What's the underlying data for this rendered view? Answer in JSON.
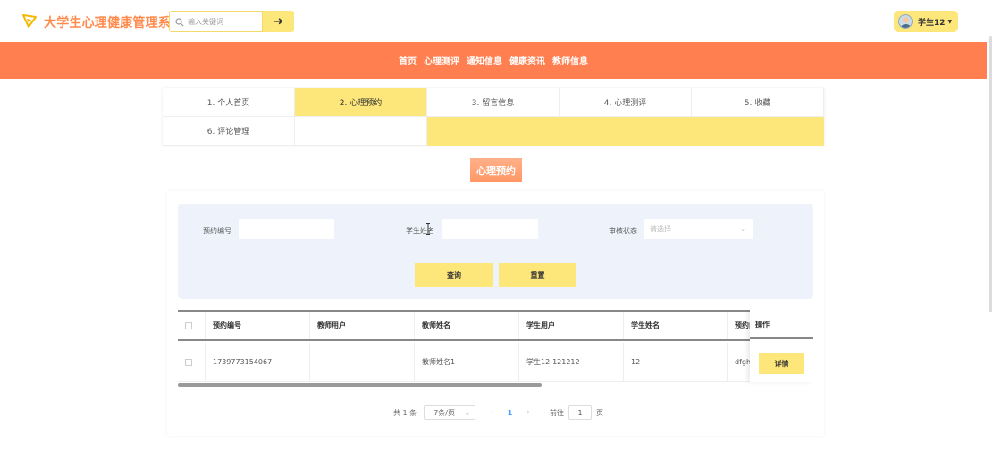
{
  "header": {
    "logo_text": "大学生心理健康管理系统",
    "search_placeholder": "输入关键词",
    "search_button": "➜",
    "user_name": "学生12",
    "user_caret": "▼"
  },
  "nav": {
    "items": [
      "首页",
      "心理测评",
      "通知信息",
      "健康资讯",
      "教师信息"
    ]
  },
  "tabs": [
    {
      "label": "1. 个人首页",
      "active": false
    },
    {
      "label": "2. 心理预约",
      "active": true
    },
    {
      "label": "3. 留言信息",
      "active": false
    },
    {
      "label": "4. 心理测评",
      "active": false
    },
    {
      "label": "5. 收藏",
      "active": false
    },
    {
      "label": "6. 评论管理",
      "active": false
    }
  ],
  "section_title": "心理预约",
  "filters": {
    "booking_no_label": "预约编号",
    "booking_no_value": "",
    "student_name_label": "学生姓名",
    "student_name_value": "",
    "status_label": "审核状态",
    "status_placeholder": "请选择",
    "query_button": "查询",
    "reset_button": "重置"
  },
  "table": {
    "columns": [
      "预约编号",
      "教师用户",
      "教师姓名",
      "学生用户",
      "学生姓名",
      "预约内"
    ],
    "rows": [
      {
        "cells": [
          "1739773154067",
          "",
          "教师姓名1",
          "学生12-121212",
          "12",
          "dfghr"
        ],
        "action": "详情"
      }
    ],
    "action_header": "操作"
  },
  "pagination": {
    "total": "共 1 条",
    "page_size": "7条/页",
    "prev": "‹",
    "current": "1",
    "next": "›",
    "jump_label": "前往",
    "jump_value": "1",
    "page_unit": "页"
  },
  "colors": {
    "brand_orange": "#ff7f50",
    "accent_yellow": "#fde67a",
    "panel_bg": "#eef3fb"
  }
}
